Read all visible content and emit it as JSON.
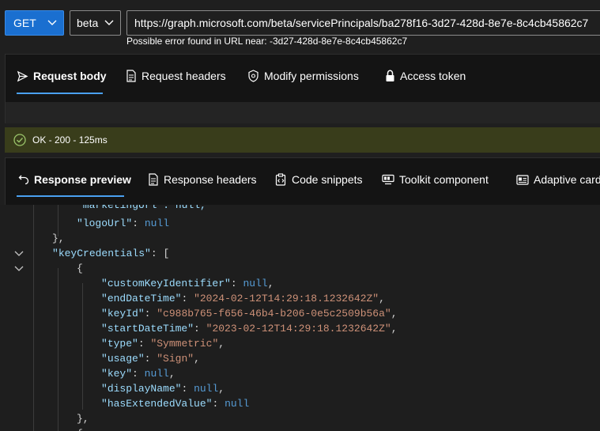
{
  "toolbar": {
    "method": "GET",
    "version": "beta",
    "url": "https://graph.microsoft.com/beta/servicePrincipals/ba278f16-3d27-428d-8e7e-8c4cb45862c7",
    "url_error": "Possible error found in URL near: -3d27-428d-8e7e-8c4cb45862c7"
  },
  "request_tabs": [
    {
      "label": "Request body",
      "icon": "send-icon"
    },
    {
      "label": "Request headers",
      "icon": "document-icon"
    },
    {
      "label": "Modify permissions",
      "icon": "shield-icon"
    },
    {
      "label": "Access token",
      "icon": "lock-icon"
    }
  ],
  "status": {
    "text": "OK - 200 - 125ms",
    "color": "#393d1b"
  },
  "response_tabs": [
    {
      "label": "Response preview",
      "icon": "back-arrow-icon"
    },
    {
      "label": "Response headers",
      "icon": "document-icon"
    },
    {
      "label": "Code snippets",
      "icon": "clipboard-code-icon"
    },
    {
      "label": "Toolkit component",
      "icon": "toolkit-icon"
    },
    {
      "label": "Adaptive cards",
      "icon": "card-icon"
    }
  ],
  "code": {
    "partial_line": "\"marketingUrl\": null,",
    "lines": [
      {
        "key": "logoUrl",
        "value": "null",
        "type": "n",
        "trail": ""
      },
      {
        "text": "},"
      },
      {
        "key": "keyCredentials",
        "value": "[",
        "type": "p",
        "trail": ""
      },
      {
        "text": "{"
      },
      {
        "key": "customKeyIdentifier",
        "value": "null",
        "type": "n",
        "trail": ","
      },
      {
        "key": "endDateTime",
        "value": "\"2024-02-12T14:29:18.1232642Z\"",
        "type": "s",
        "trail": ","
      },
      {
        "key": "keyId",
        "value": "\"c988b765-f656-46b4-b206-0e5c2509b56a\"",
        "type": "s",
        "trail": ","
      },
      {
        "key": "startDateTime",
        "value": "\"2023-02-12T14:29:18.1232642Z\"",
        "type": "s",
        "trail": ","
      },
      {
        "key": "type",
        "value": "\"Symmetric\"",
        "type": "s",
        "trail": ","
      },
      {
        "key": "usage",
        "value": "\"Sign\"",
        "type": "s",
        "trail": ","
      },
      {
        "key": "key",
        "value": "null",
        "type": "n",
        "trail": ","
      },
      {
        "key": "displayName",
        "value": "null",
        "type": "n",
        "trail": ","
      },
      {
        "key": "hasExtendedValue",
        "value": "null",
        "type": "n",
        "trail": ""
      },
      {
        "text": "},"
      },
      {
        "text": "{"
      }
    ]
  }
}
